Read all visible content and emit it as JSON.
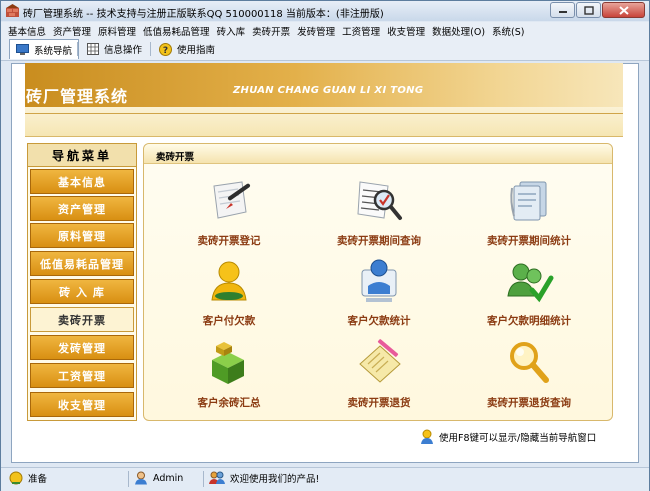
{
  "window": {
    "title": "砖厂管理系统 -- 技术支持与注册正版联系QQ 510000118   当前版本：(非注册版)"
  },
  "menu": [
    "基本信息",
    "资产管理",
    "原料管理",
    "低值易耗品管理",
    "砖入库",
    "卖砖开票",
    "发砖管理",
    "工资管理",
    "收支管理",
    "数据处理(O)",
    "系统(S)"
  ],
  "toolbar": {
    "nav_tab": "系统导航",
    "info_op": "信息操作",
    "guide": "使用指南"
  },
  "banner": {
    "title": "砖厂管理系统",
    "subtitle": "ZHUAN CHANG GUAN LI XI TONG"
  },
  "nav": {
    "header": "导航菜单",
    "items": [
      "基本信息",
      "资产管理",
      "原料管理",
      "低值易耗品管理",
      "砖 入 库",
      "卖砖开票",
      "发砖管理",
      "工资管理",
      "收支管理"
    ],
    "selected_index": 5
  },
  "content": {
    "title": "卖砖开票",
    "functions": [
      {
        "label": "卖砖开票登记",
        "icon": "edit-pen-icon"
      },
      {
        "label": "卖砖开票期间查询",
        "icon": "search-document-icon"
      },
      {
        "label": "卖砖开票期间统计",
        "icon": "document-stack-icon"
      },
      {
        "label": "客户付欠款",
        "icon": "user-yellow-icon"
      },
      {
        "label": "客户欠款统计",
        "icon": "person-chart-icon"
      },
      {
        "label": "客户欠款明细统计",
        "icon": "users-check-icon"
      },
      {
        "label": "客户余砖汇总",
        "icon": "green-cubes-icon"
      },
      {
        "label": "卖砖开票退货",
        "icon": "notepad-pencil-icon"
      },
      {
        "label": "卖砖开票退货查询",
        "icon": "magnifier-icon"
      }
    ],
    "hint": "使用F8键可以显示/隐藏当前导航窗口"
  },
  "status": {
    "ready": "准备",
    "user": "Admin",
    "welcome": "欢迎使用我们的产品!"
  },
  "colors": {
    "nav_item": "#d88f12",
    "label": "#8b3b12",
    "banner": "#c98d1f"
  }
}
